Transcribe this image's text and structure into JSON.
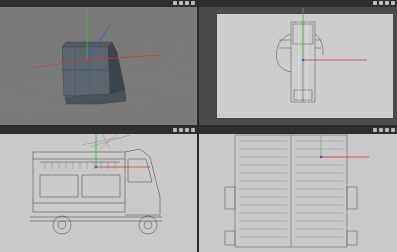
{
  "viewports": [
    {
      "name": "",
      "menu": [
        "",
        "",
        "",
        "",
        "",
        ""
      ],
      "status": ""
    },
    {
      "name": "",
      "menu": [
        "",
        "",
        "",
        "",
        "",
        ""
      ],
      "status": ""
    },
    {
      "name": "",
      "menu": [
        "",
        "",
        "",
        "",
        "",
        ""
      ],
      "status": ""
    },
    {
      "name": "",
      "menu": [
        "",
        "",
        "",
        "",
        "",
        ""
      ],
      "status": ""
    }
  ],
  "colors": {
    "axis_x": "#e03030",
    "axis_y": "#2fbf2f",
    "axis_z": "#3060e0",
    "perspective_bg": "#7a7a7a",
    "ortho_bg": "#c9c9c9",
    "wire": "#333333",
    "selected_wire": "#f0f0f0"
  }
}
